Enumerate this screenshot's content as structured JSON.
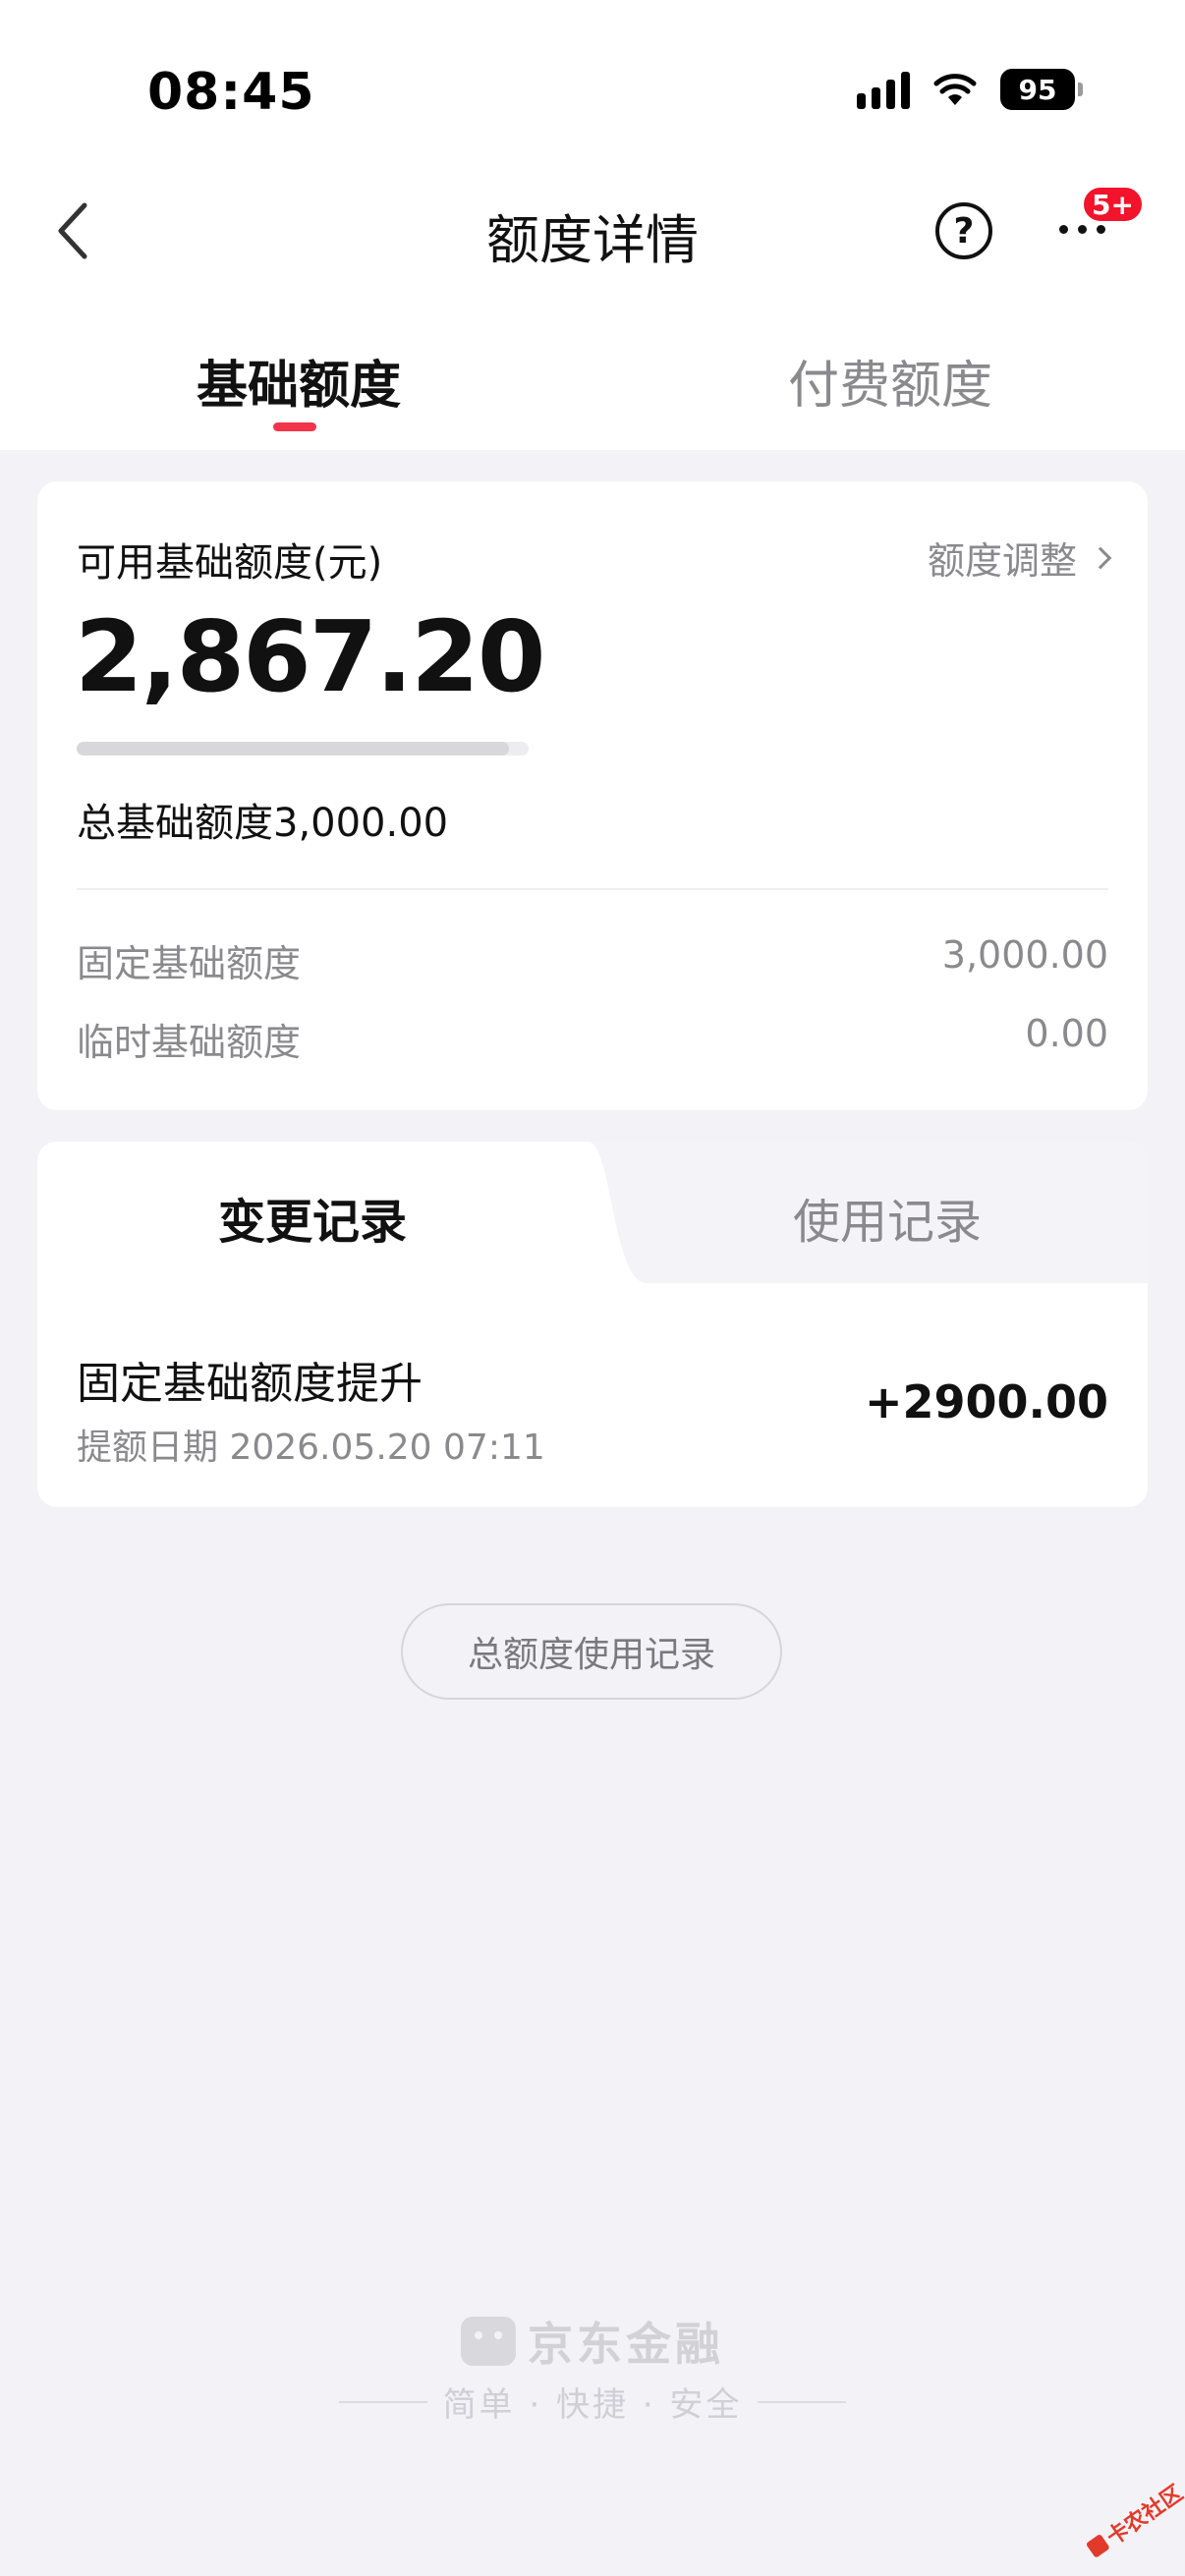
{
  "status_bar": {
    "time": "08:45",
    "battery": "95"
  },
  "nav": {
    "title": "额度详情",
    "help": "?",
    "badge": "5+"
  },
  "tabs": [
    {
      "label": "基础额度",
      "active": true
    },
    {
      "label": "付费额度",
      "active": false
    }
  ],
  "summary": {
    "available_label": "可用基础额度(元)",
    "adjust_label": "额度调整",
    "available_amount": "2,867.20",
    "usage_fraction": 0.956,
    "total_label": "总基础额度3,000.00",
    "rows": [
      {
        "label": "固定基础额度",
        "value": "3,000.00"
      },
      {
        "label": "临时基础额度",
        "value": "0.00"
      }
    ]
  },
  "records": {
    "tabs": [
      {
        "label": "变更记录",
        "active": true
      },
      {
        "label": "使用记录",
        "active": false
      }
    ],
    "items": [
      {
        "title": "固定基础额度提升",
        "date": "提额日期 2026.05.20 07:11",
        "amount": "+2900.00"
      }
    ]
  },
  "total_usage_button": "总额度使用记录",
  "footer": {
    "brand": "京东金融",
    "slogan": "简单 · 快捷 · 安全"
  },
  "watermark": "卡农社区",
  "colors": {
    "accent": "#f2344b",
    "badge": "#f2142b",
    "background": "#f2f2f7"
  }
}
